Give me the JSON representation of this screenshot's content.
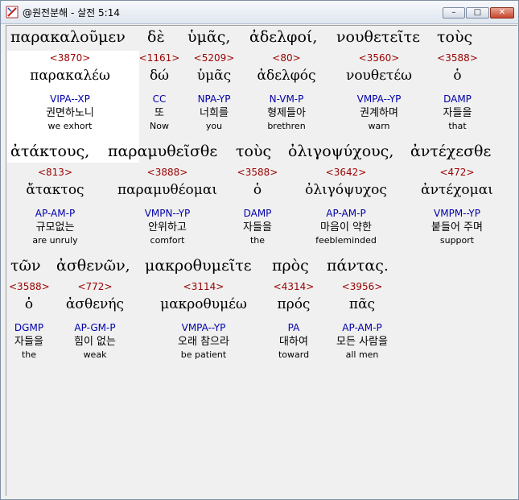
{
  "window": {
    "title": "@원전분해 - 살전 5:14",
    "minimize": "–",
    "maximize": "□",
    "close": "✕"
  },
  "lines": [
    {
      "words": [
        {
          "greek": "παρακαλοῦμεν",
          "strong": "<3870>",
          "lemma": "παρακαλέω",
          "parse": "VIPA--XP",
          "korean": "권면하노니",
          "english": "we exhort"
        },
        {
          "greek": "δὲ",
          "strong": "<1161>",
          "lemma": "δώ",
          "parse": "CC",
          "korean": "또",
          "english": "Now"
        },
        {
          "greek": "ὑμᾶς,",
          "strong": "<5209>",
          "lemma": "ὑμᾶς",
          "parse": "NPA-YP",
          "korean": "너희를",
          "english": "you"
        },
        {
          "greek": "ἀδελφοί,",
          "strong": "<80>",
          "lemma": "ἀδελφός",
          "parse": "N-VM-P",
          "korean": "형제들아",
          "english": "brethren"
        },
        {
          "greek": "νουθετεῖτε",
          "strong": "<3560>",
          "lemma": "νουθετέω",
          "parse": "VMPA--YP",
          "korean": "권계하며",
          "english": "warn"
        },
        {
          "greek": "τοὺς",
          "strong": "<3588>",
          "lemma": "ὁ",
          "parse": "DAMP",
          "korean": "자들을",
          "english": "that"
        }
      ]
    },
    {
      "words": [
        {
          "greek": "ἀτάκτους,",
          "strong": "<813>",
          "lemma": "ἄτακτος",
          "parse": "AP-AM-P",
          "korean": "규모없는",
          "english": "are unruly"
        },
        {
          "greek": "παραμυθεῖσθε",
          "strong": "<3888>",
          "lemma": "παραμυθέομαι",
          "parse": "VMPN--YP",
          "korean": "안위하고",
          "english": "comfort"
        },
        {
          "greek": "τοὺς",
          "strong": "<3588>",
          "lemma": "ὁ",
          "parse": "DAMP",
          "korean": "자들을",
          "english": "the"
        },
        {
          "greek": "ὀλιγοψύχους,",
          "strong": "<3642>",
          "lemma": "ὀλιγόψυχος",
          "parse": "AP-AM-P",
          "korean": "마음이 약한",
          "english": "feebleminded"
        },
        {
          "greek": "ἀντέχεσθε",
          "strong": "<472>",
          "lemma": "ἀντέχομαι",
          "parse": "VMPM--YP",
          "korean": "붙들어 주며",
          "english": "support"
        }
      ]
    },
    {
      "words": [
        {
          "greek": "τῶν",
          "strong": "<3588>",
          "lemma": "ὁ",
          "parse": "DGMP",
          "korean": "자들을",
          "english": "the"
        },
        {
          "greek": "ἀσθενῶν,",
          "strong": "<772>",
          "lemma": "ἀσθενής",
          "parse": "AP-GM-P",
          "korean": "힘이 없는",
          "english": "weak"
        },
        {
          "greek": "μακροθυμεῖτε",
          "strong": "<3114>",
          "lemma": "μακροθυμέω",
          "parse": "VMPA--YP",
          "korean": "오래 참으라",
          "english": "be patient"
        },
        {
          "greek": "πρὸς",
          "strong": "<4314>",
          "lemma": "πρός",
          "parse": "PA",
          "korean": "대하여",
          "english": "toward"
        },
        {
          "greek": "πάντας.",
          "strong": "<3956>",
          "lemma": "πᾶς",
          "parse": "AP-AM-P",
          "korean": "모든 사람을",
          "english": "all men"
        }
      ]
    }
  ],
  "colors": {
    "strong": "#990000",
    "parse": "#0000aa",
    "highlight": "#ffffff",
    "background": "#f0f0f0"
  }
}
